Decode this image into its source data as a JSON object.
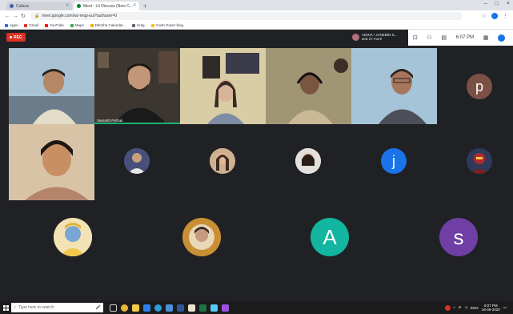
{
  "browser": {
    "tabs": [
      {
        "title": "Culture",
        "favicon_color": "#4a5cb5",
        "active": false
      },
      {
        "title": "Meet - Lit Discuss (New C...",
        "favicon_color": "#00832d",
        "active": true
      }
    ],
    "new_tab_label": "+",
    "url": "meet.google.com/wz-reqp-uul?authuser=0",
    "bookmarks": [
      {
        "label": "Apps",
        "color": "#1a73e8"
      },
      {
        "label": "Gmail",
        "color": "#d93025"
      },
      {
        "label": "YouTube",
        "color": "#ff0000"
      },
      {
        "label": "Maps",
        "color": "#34a853"
      },
      {
        "label": "DIKSha Calendar...",
        "color": "#f9ab00"
      },
      {
        "label": "Krkg",
        "color": "#5f6368"
      },
      {
        "label": "Youth Toastr blog",
        "color": "#fbbc04"
      }
    ]
  },
  "meet": {
    "rec_label": "REC",
    "presenting_names": "ADINA / JANEBIN S...",
    "presenting_more": "and 27 more",
    "clock": "6:07 PM",
    "participants_with_video": [
      {
        "name": "",
        "bg": "#8ab0c8"
      },
      {
        "name": "Samarth Pathak",
        "bg": "#3a3632",
        "speaking": true
      },
      {
        "name": "",
        "bg": "#d9cfa8"
      },
      {
        "name": "",
        "bg": "#9d9478"
      },
      {
        "name": "",
        "bg": "#9ebdd4"
      },
      {
        "name": "",
        "bg": "#d6b48a"
      }
    ],
    "letter_avatars": [
      {
        "letter": "p",
        "color": "#7b5146"
      },
      {
        "letter": "j",
        "color": "#1a73e8"
      },
      {
        "letter": "A",
        "color": "#12b5a0"
      },
      {
        "letter": "s",
        "color": "#6f3fa5"
      }
    ]
  },
  "taskbar": {
    "search_placeholder": "Type here to search",
    "time": "6:07 PM",
    "date": "16-06-2020",
    "lang": "ENG"
  }
}
